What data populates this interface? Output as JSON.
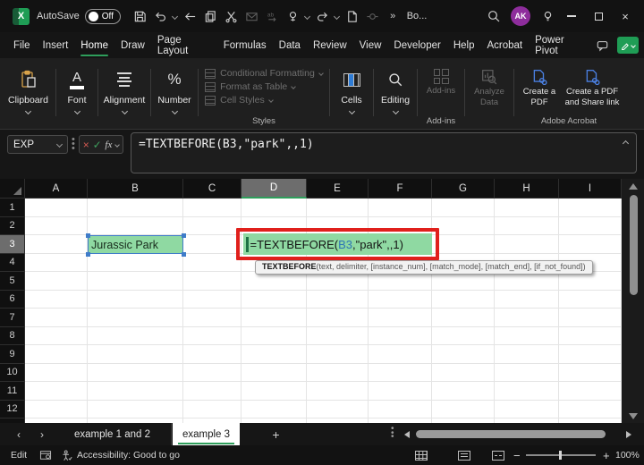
{
  "titlebar": {
    "autosave_label": "AutoSave",
    "autosave_state": "Off",
    "doc_title": "Bo...",
    "avatar": "AK"
  },
  "tabs": [
    "File",
    "Insert",
    "Home",
    "Draw",
    "Page Layout",
    "Formulas",
    "Data",
    "Review",
    "View",
    "Developer",
    "Help",
    "Acrobat",
    "Power Pivot"
  ],
  "active_tab": "Home",
  "ribbon": {
    "clipboard": "Clipboard",
    "font": "Font",
    "alignment": "Alignment",
    "number": "Number",
    "styles_items": [
      "Conditional Formatting",
      "Format as Table",
      "Cell Styles"
    ],
    "styles_label": "Styles",
    "cells": "Cells",
    "editing": "Editing",
    "addins_button": "Add-ins",
    "addins_label": "Add-ins",
    "analyze_button": "Analyze Data",
    "acrobat_button1": "Create a PDF",
    "acrobat_button2": "Create a PDF and Share link",
    "acrobat_label": "Adobe Acrobat"
  },
  "formula_bar": {
    "name_box": "EXP",
    "formula": "=TEXTBEFORE(B3,\"park\",,1)"
  },
  "grid": {
    "columns": [
      "A",
      "B",
      "C",
      "D",
      "E",
      "F",
      "G",
      "H",
      "I"
    ],
    "row_count": 13,
    "selected_column": "D",
    "selected_row": 3,
    "b3_value": "Jurassic Park",
    "d3_formula": {
      "prefix": "=TEXTBEFORE(",
      "ref": "B3",
      "suffix": ",\"park\",,1)"
    },
    "tooltip": {
      "name": "TEXTBEFORE",
      "args": "(text, delimiter, [instance_num], [match_mode], [match_end], [if_not_found])"
    }
  },
  "sheet_bar": {
    "tab1": "example 1 and 2",
    "tab2": "example 3"
  },
  "status_bar": {
    "mode": "Edit",
    "accessibility": "Accessibility: Good to go",
    "zoom_level": "100%"
  },
  "colors": {
    "excel_green": "#1F9D55",
    "cell_fill_green": "#8FD9A2",
    "annotation_red": "#E0201C",
    "reference_blue": "#2E75B6",
    "avatar_purple": "#8E2D9C"
  }
}
